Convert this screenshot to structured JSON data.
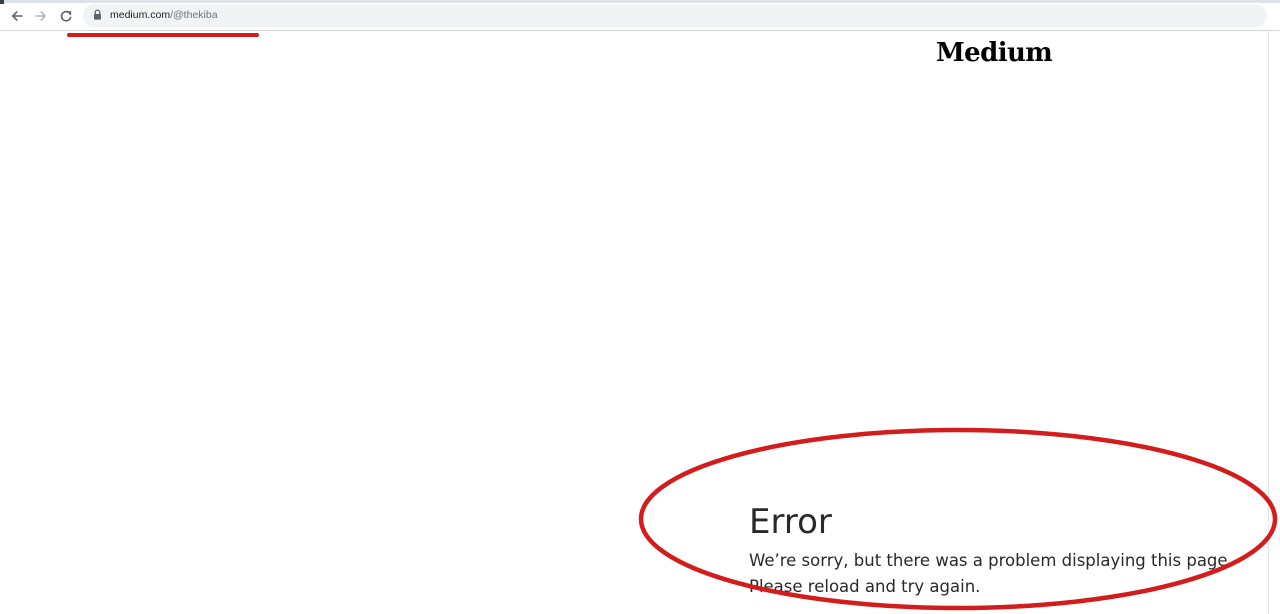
{
  "browser": {
    "url_host": "medium.com",
    "url_path": "/@thekiba",
    "icons": {
      "back": "arrow-left-icon",
      "forward": "arrow-right-icon",
      "reload": "reload-icon",
      "secure": "lock-icon"
    }
  },
  "page": {
    "brand": "Medium",
    "error": {
      "title": "Error",
      "line1": "We’re sorry, but there was a problem displaying this page",
      "line2": "Please reload and try again."
    }
  },
  "colors": {
    "annotation_red": "#d31c1c",
    "text": "#292929",
    "omnibox_bg": "#f1f3f4"
  }
}
